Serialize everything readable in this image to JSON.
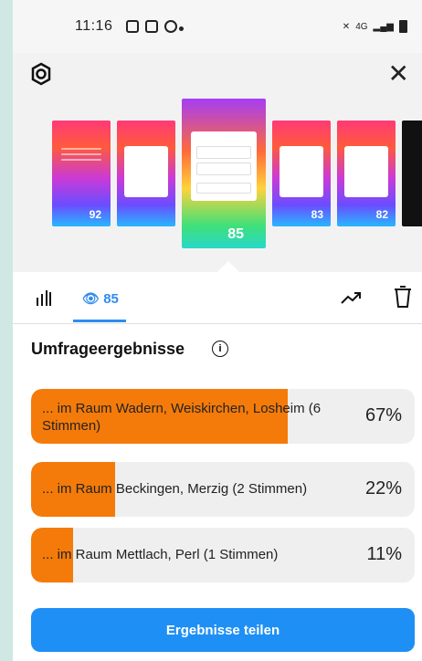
{
  "status_bar": {
    "time": "11:16",
    "network": "4G"
  },
  "stories": [
    {
      "views": "92"
    },
    {
      "views": ""
    },
    {
      "views": "85"
    },
    {
      "views": "83"
    },
    {
      "views": "82"
    }
  ],
  "tabs": {
    "view_count": "85"
  },
  "results": {
    "title": "Umfrageergebnisse",
    "options": [
      {
        "label": "... im Raum Wadern, Weiskirchen, Losheim (6 Stimmen)",
        "percent_text": "67%",
        "percent": 67
      },
      {
        "label": "... im Raum Beckingen, Merzig (2 Stimmen)",
        "percent_text": "22%",
        "percent": 22
      },
      {
        "label": "... im Raum Mettlach, Perl (1 Stimmen)",
        "percent_text": "11%",
        "percent": 11
      }
    ]
  },
  "share_button": "Ergebnisse teilen",
  "colors": {
    "accent": "#2f8cf0",
    "bar_fill": "#f47b0a",
    "button": "#1e8ff5"
  }
}
